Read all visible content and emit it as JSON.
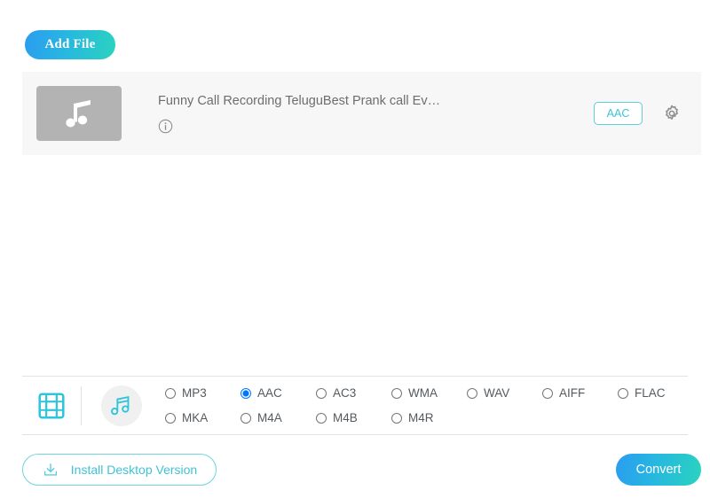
{
  "toolbar": {
    "add_file_label": "Add File"
  },
  "file_row": {
    "thumbnail_icon": "music-note-icon",
    "file_name": "Funny Call Recording TeluguBest Prank call Ev…",
    "info_icon": "info-circle-icon",
    "output_format_label": "AAC",
    "settings_icon": "gear-icon"
  },
  "format_bar": {
    "video_tab_icon": "film-strip-icon",
    "audio_tab_icon": "music-notes-icon",
    "selected_format": "AAC",
    "formats": [
      {
        "label": "MP3",
        "selected": false
      },
      {
        "label": "AAC",
        "selected": true
      },
      {
        "label": "AC3",
        "selected": false
      },
      {
        "label": "WMA",
        "selected": false
      },
      {
        "label": "WAV",
        "selected": false
      },
      {
        "label": "AIFF",
        "selected": false
      },
      {
        "label": "FLAC",
        "selected": false
      },
      {
        "label": "MKA",
        "selected": false
      },
      {
        "label": "M4A",
        "selected": false
      },
      {
        "label": "M4B",
        "selected": false
      },
      {
        "label": "M4R",
        "selected": false
      }
    ]
  },
  "bottom_bar": {
    "install_label": "Install Desktop Version",
    "install_icon": "download-icon",
    "convert_label": "Convert"
  },
  "colors": {
    "accent_cyan": "#3fc3d6",
    "gradient_start": "#2b9cf0",
    "gradient_end": "#2ad3bf",
    "radio_selected": "#1a73e8",
    "row_background": "#f7f7f7",
    "thumbnail_gray": "#b3b3b3"
  }
}
